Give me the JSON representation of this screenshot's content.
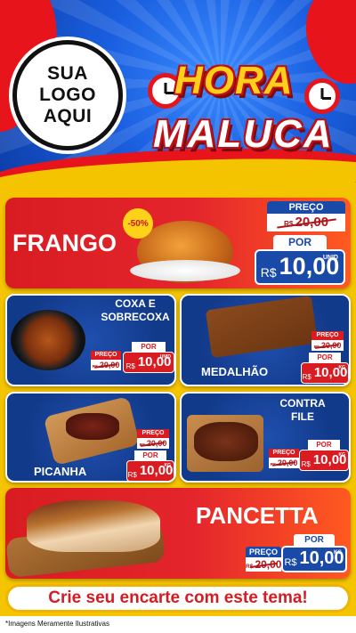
{
  "logo": {
    "line1": "SUA",
    "line2": "LOGO",
    "line3": "AQUI"
  },
  "headline": {
    "line1": "HORA",
    "line2": "MALUCA"
  },
  "products": {
    "frango": {
      "name": "FRANGO",
      "badge": "-50%",
      "old_label": "PREÇO",
      "old_currency": "R$",
      "old_price": "20,00",
      "new_label": "POR",
      "currency": "R$",
      "price": "10,00",
      "unit": "UNID"
    },
    "coxa": {
      "name_line1": "COXA E",
      "name_line2": "SOBRECOXA",
      "old_label": "PREÇO",
      "old_currency": "R$",
      "old_price": "20,00",
      "new_label": "POR",
      "currency": "R$",
      "price": "10,00",
      "unit": "UNID"
    },
    "medalhao": {
      "name": "MEDALHÃO",
      "old_label": "PREÇO",
      "old_currency": "R$",
      "old_price": "20,00",
      "new_label": "POR",
      "currency": "R$",
      "price": "10,00",
      "unit": "KG"
    },
    "picanha": {
      "name": "PICANHA",
      "old_label": "PREÇO",
      "old_currency": "R$",
      "old_price": "20,00",
      "new_label": "POR",
      "currency": "R$",
      "price": "10,00",
      "unit": "KG"
    },
    "contrafile": {
      "name_line1": "CONTRA",
      "name_line2": "FILE",
      "old_label": "PREÇO",
      "old_currency": "R$",
      "old_price": "20,00",
      "new_label": "POR",
      "currency": "R$",
      "price": "10,00",
      "unit": "KG"
    },
    "pancetta": {
      "name": "PANCETTA",
      "old_label": "PREÇO",
      "old_currency": "R$",
      "old_price": "20,00",
      "new_label": "POR",
      "currency": "R$",
      "price": "10,00",
      "unit": "KG"
    }
  },
  "footer": {
    "cta": "Crie seu encarte com este tema!",
    "disclaimer": "*Imagens Meramente Ilustrativas"
  },
  "colors": {
    "red": "#e4262c",
    "blue": "#1a4aa8",
    "yellow": "#f5c400",
    "orange": "#f39c12"
  }
}
